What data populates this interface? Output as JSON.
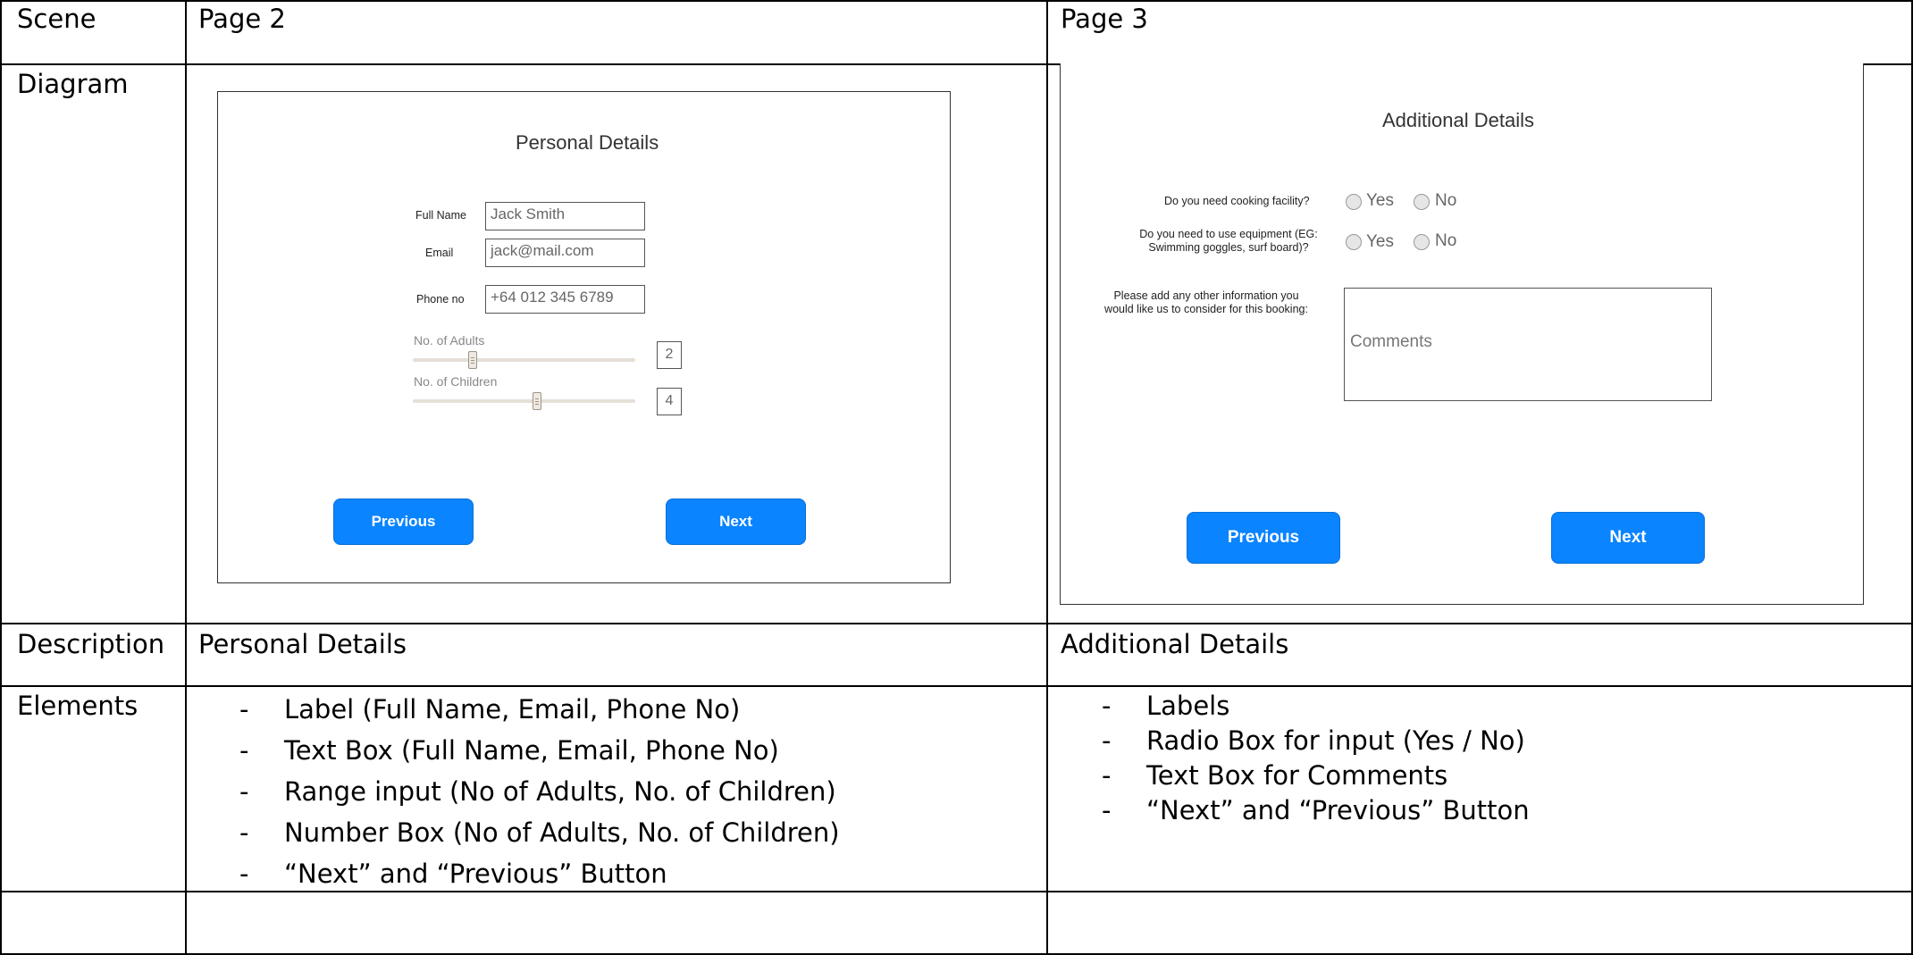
{
  "table": {
    "headers": {
      "scene": "Scene",
      "page2": "Page 2",
      "page3": "Page 3"
    },
    "row_labels": {
      "diagram": "Diagram",
      "description": "Description",
      "elements": "Elements"
    },
    "descriptions": {
      "page2": "Personal Details",
      "page3": "Additional Details"
    },
    "bullet_dash": "-",
    "elements_page2": [
      "Label (Full Name, Email, Phone No)",
      "Text Box (Full Name, Email, Phone No)",
      "Range input (No of Adults, No. of Children)",
      "Number Box (No of Adults, No. of Children)",
      "“Next” and “Previous” Button"
    ],
    "elements_page3": [
      "Labels",
      "Radio Box for input (Yes / No)",
      "Text Box for Comments",
      "“Next” and “Previous” Button"
    ]
  },
  "page2_mockup": {
    "title": "Personal Details",
    "full_name_label": "Full Name",
    "full_name_value": "Jack Smith",
    "email_label": "Email",
    "email_value": "jack@mail.com",
    "phone_label": "Phone no",
    "phone_value": "+64 012 345 6789",
    "adults_label": "No. of Adults",
    "adults_value": "2",
    "adults_level": 0.27,
    "children_label": "No. of Children",
    "children_value": "4",
    "children_level": 0.56,
    "previous_label": "Previous",
    "next_label": "Next",
    "button_color": "#0a84ff"
  },
  "page3_mockup": {
    "title": "Additional Details",
    "q1_label": "Do you need cooking facility?",
    "q2_label_line1": "Do you need to use equipment (EG:",
    "q2_label_line2": "Swimming goggles, surf board)?",
    "q3_label_line1": "Please add any other information you",
    "q3_label_line2": "would like us to consider for this booking:",
    "yes_label": "Yes",
    "no_label": "No",
    "comments_placeholder": "Comments",
    "previous_label": "Previous",
    "next_label": "Next",
    "button_color": "#0a84ff"
  }
}
